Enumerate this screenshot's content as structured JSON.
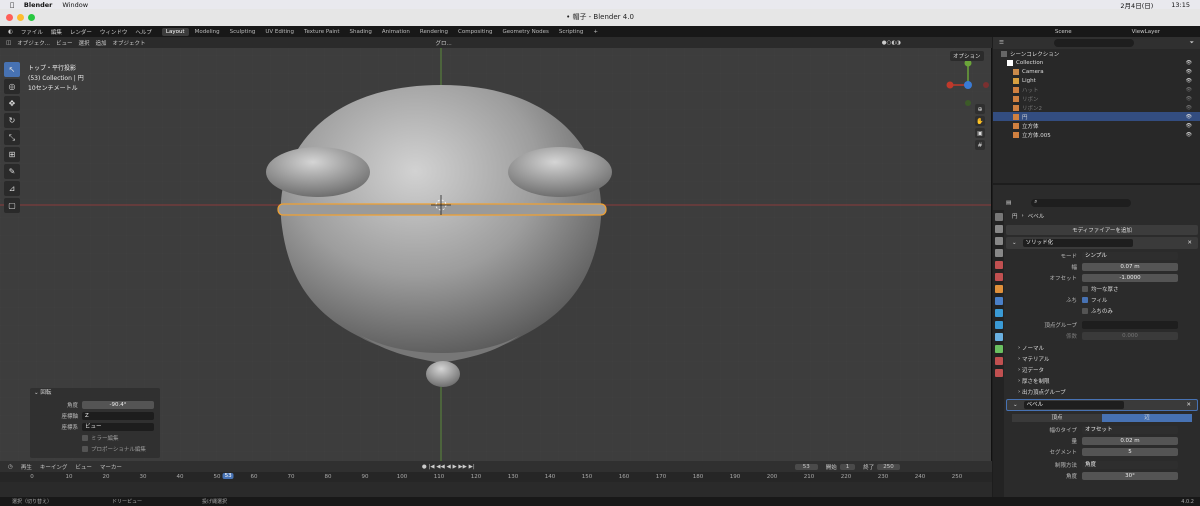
{
  "mac_menu": {
    "apple": "",
    "app": "Blender",
    "window": "Window",
    "date": "2月4日(日)",
    "time": "13:15"
  },
  "window_title": "• 帽子 - Blender 4.0",
  "top_menu": [
    "ファイル",
    "編集",
    "レンダー",
    "ウィンドウ",
    "ヘルプ"
  ],
  "workspaces": [
    "Layout",
    "Modeling",
    "Sculpting",
    "UV Editing",
    "Texture Paint",
    "Shading",
    "Animation",
    "Rendering",
    "Compositing",
    "Geometry Nodes",
    "Scripting"
  ],
  "active_workspace": "Layout",
  "scene": "Scene",
  "view_layer": "ViewLayer",
  "viewport_header": {
    "mode": "オブジェク...",
    "menus": [
      "ビュー",
      "選択",
      "追加",
      "オブジェクト"
    ],
    "transform": "グロ...",
    "options": "オプション"
  },
  "viewport_info": {
    "line1": "トップ・平行投影",
    "line2": "(53) Collection | 円",
    "line3": "10センチメートル"
  },
  "operator_panel": {
    "title": "回転",
    "angle_label": "角度",
    "angle_value": "-90.4°",
    "axis_label": "座標軸",
    "axis_value": "Z",
    "orient_label": "座標系",
    "orient_value": "ビュー",
    "mirror": "ミラー編集",
    "proportional": "プロポーショナル編集"
  },
  "timeline": {
    "menus": [
      "再生",
      "キーイング",
      "ビュー",
      "マーカー"
    ],
    "current_frame": "53",
    "start_label": "開始",
    "start": "1",
    "end_label": "終了",
    "end": "250",
    "ticks": [
      "0",
      "10",
      "20",
      "30",
      "40",
      "50",
      "60",
      "70",
      "80",
      "90",
      "100",
      "110",
      "120",
      "130",
      "140",
      "150",
      "160",
      "170",
      "180",
      "190",
      "200",
      "210",
      "220",
      "230",
      "240",
      "250"
    ],
    "cursor_label": "53"
  },
  "status_bar": {
    "select": "選択（切り替え）",
    "drag": "ドリーピュー",
    "lasso": "投げ縄選択",
    "version": "4.0.2"
  },
  "outliner": {
    "title": "シーンコレクション",
    "items": [
      {
        "name": "Collection",
        "dim": false,
        "selected": false
      },
      {
        "name": "Camera",
        "dim": false,
        "selected": false
      },
      {
        "name": "Light",
        "dim": false,
        "selected": false
      },
      {
        "name": "ハット",
        "dim": true,
        "selected": false
      },
      {
        "name": "リボン",
        "dim": true,
        "selected": false
      },
      {
        "name": "リボン2",
        "dim": true,
        "selected": false
      },
      {
        "name": "円",
        "dim": false,
        "selected": true
      },
      {
        "name": "立方体",
        "dim": false,
        "selected": false
      },
      {
        "name": "立方体.005",
        "dim": false,
        "selected": false
      }
    ]
  },
  "properties": {
    "breadcrumb_obj": "円",
    "breadcrumb_mod": "ベベル",
    "add_modifier": "モディファイアーを追加",
    "solidify": {
      "name": "ソリッド化",
      "mode_label": "モード",
      "mode_value": "シンプル",
      "width_label": "幅",
      "width_value": "0.07 m",
      "offset_label": "オフセット",
      "offset_value": "-1.0000",
      "even": "均一な厚さ",
      "rim_label": "ふち",
      "fill": "フィル",
      "rim_only": "ふちのみ",
      "vgroup_label": "頂点グループ",
      "factor_label": "係数",
      "factor_value": "0.000",
      "sections": [
        "ノーマル",
        "マテリアル",
        "辺データ",
        "厚さを制限",
        "出力頂点グループ"
      ]
    },
    "bevel": {
      "name": "ベベル",
      "tab_vertex": "頂点",
      "tab_edge": "辺",
      "width_type_label": "幅のタイプ",
      "width_type_value": "オフセット",
      "amount_label": "量",
      "amount_value": "0.02 m",
      "segments_label": "セグメント",
      "segments_value": "5",
      "limit_label": "制限方法",
      "limit_value": "角度",
      "angle_label": "角度",
      "angle_value": "30°"
    }
  }
}
